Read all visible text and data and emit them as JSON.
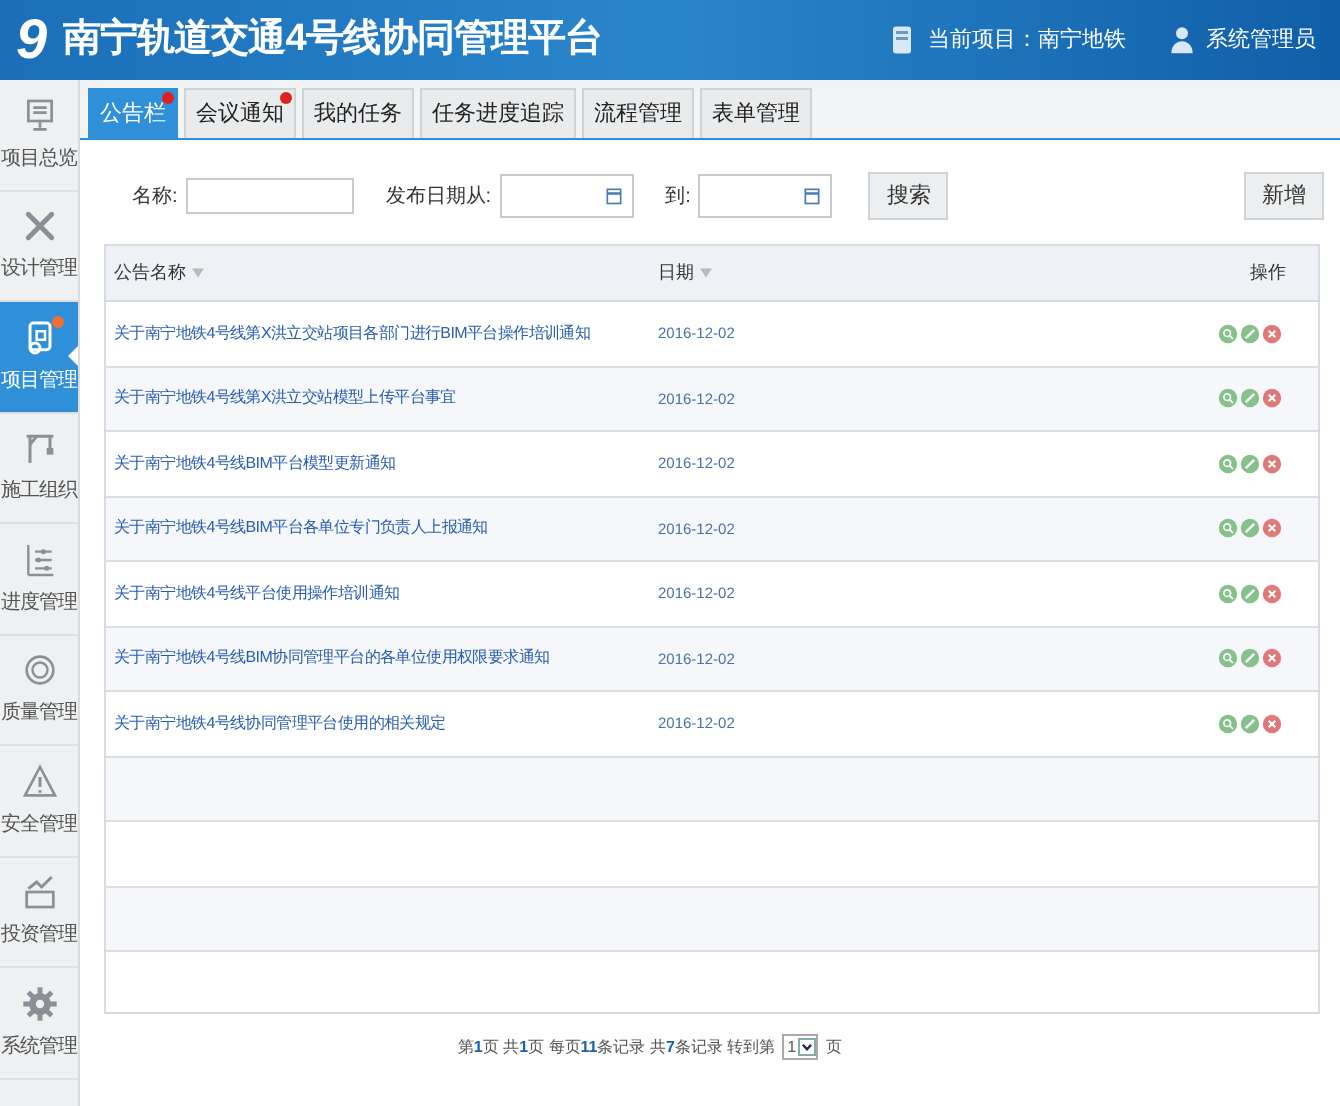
{
  "header": {
    "logo": "9",
    "title": "南宁轨道交通4号线协同管理平台",
    "project": "当前项目：南宁地铁",
    "user": "系统管理员"
  },
  "sidebar": {
    "items": [
      {
        "label": "项目总览",
        "kind": "monitor",
        "selected": false,
        "dot": false
      },
      {
        "label": "设计管理",
        "kind": "tools",
        "selected": false,
        "dot": false
      },
      {
        "label": "项目管理",
        "kind": "clipboard",
        "selected": true,
        "dot": true
      },
      {
        "label": "施工组织",
        "kind": "crane",
        "selected": false,
        "dot": false
      },
      {
        "label": "进度管理",
        "kind": "sliders",
        "selected": false,
        "dot": false
      },
      {
        "label": "质量管理",
        "kind": "seal",
        "selected": false,
        "dot": false
      },
      {
        "label": "安全管理",
        "kind": "warning",
        "selected": false,
        "dot": false
      },
      {
        "label": "投资管理",
        "kind": "chart",
        "selected": false,
        "dot": false
      },
      {
        "label": "系统管理",
        "kind": "gear",
        "selected": false,
        "dot": false
      }
    ]
  },
  "tabs": [
    {
      "label": "公告栏",
      "selected": true,
      "dot": true
    },
    {
      "label": "会议通知",
      "selected": false,
      "dot": true
    },
    {
      "label": "我的任务",
      "selected": false,
      "dot": false
    },
    {
      "label": "任务进度追踪",
      "selected": false,
      "dot": false
    },
    {
      "label": "流程管理",
      "selected": false,
      "dot": false
    },
    {
      "label": "表单管理",
      "selected": false,
      "dot": false
    }
  ],
  "search": {
    "name_label": "名称:",
    "date_from_label": "发布日期从:",
    "date_to_label": "到:",
    "search_button": "搜索",
    "add_button": "新增"
  },
  "table": {
    "columns": [
      "公告名称",
      "日期",
      "操作"
    ],
    "rows": [
      {
        "title": "关于南宁地铁4号线第X洪立交站项目各部门进行BIM平台操作培训通知",
        "date": "2016-12-02"
      },
      {
        "title": "关于南宁地铁4号线第X洪立交站模型上传平台事宜",
        "date": "2016-12-02"
      },
      {
        "title": "关于南宁地铁4号线BIM平台模型更新通知",
        "date": "2016-12-02"
      },
      {
        "title": "关于南宁地铁4号线BIM平台各单位专门负责人上报通知",
        "date": "2016-12-02"
      },
      {
        "title": "关于南宁地铁4号线平台使用操作培训通知",
        "date": "2016-12-02"
      },
      {
        "title": "关于南宁地铁4号线BIM协同管理平台的各单位使用权限要求通知",
        "date": "2016-12-02"
      },
      {
        "title": "关于南宁地铁4号线协同管理平台使用的相关规定",
        "date": "2016-12-02"
      }
    ]
  },
  "pagination": {
    "summary": "第**1**页 共**1**页 每页**11**条记录 共**7**条记录 转到第",
    "page": "1",
    "suffix": "页"
  }
}
